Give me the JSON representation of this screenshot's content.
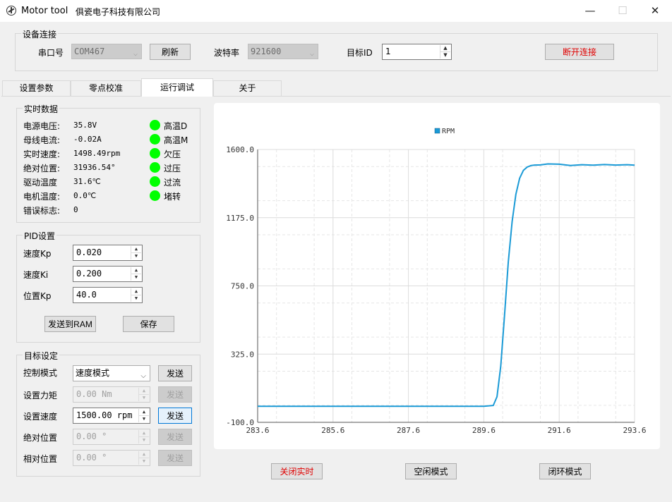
{
  "window": {
    "title": "Motor tool",
    "subtitle": "俱瓷电子科技有限公司",
    "minimize_glyph": "—",
    "maximize_glyph": "☐",
    "close_glyph": "✕"
  },
  "connection": {
    "group_title": "设备连接",
    "port_label": "串口号",
    "port_value": "COM467",
    "refresh_label": "刷新",
    "baud_label": "波特率",
    "baud_value": "921600",
    "target_id_label": "目标ID",
    "target_id_value": "1",
    "disconnect_label": "断开连接",
    "accent_color": "#e00000"
  },
  "tabs": [
    {
      "label": "设置参数"
    },
    {
      "label": "零点校准"
    },
    {
      "label": "运行调试",
      "active": true
    },
    {
      "label": "关于"
    }
  ],
  "realtime": {
    "group_title": "实时数据",
    "rows": [
      {
        "label": "电源电压:",
        "value": "35.8V"
      },
      {
        "label": "母线电流:",
        "value": "-0.02A"
      },
      {
        "label": "实时速度:",
        "value": "1498.49rpm"
      },
      {
        "label": "绝对位置:",
        "value": "31936.54°"
      },
      {
        "label": "驱动温度",
        "value": "31.6℃"
      },
      {
        "label": "电机温度:",
        "value": "0.0℃"
      },
      {
        "label": "错误标志:",
        "value": "0"
      }
    ],
    "indicators": [
      {
        "label": "高温D",
        "color": "#00ff00"
      },
      {
        "label": "高温M",
        "color": "#00ff00"
      },
      {
        "label": "欠压",
        "color": "#00ff00"
      },
      {
        "label": "过压",
        "color": "#00ff00"
      },
      {
        "label": "过流",
        "color": "#00ff00"
      },
      {
        "label": "堵转",
        "color": "#00ff00"
      }
    ]
  },
  "pid": {
    "group_title": "PID设置",
    "rows": [
      {
        "label": "速度Kp",
        "value": "0.020"
      },
      {
        "label": "速度Ki",
        "value": "0.200"
      },
      {
        "label": "位置Kp",
        "value": "40.0"
      }
    ],
    "send_ram_label": "发送到RAM",
    "save_label": "保存"
  },
  "target": {
    "group_title": "目标设定",
    "mode_label": "控制模式",
    "mode_value": "速度模式",
    "rows": [
      {
        "label": "设置力矩",
        "value": "0.00 Nm",
        "enabled": false
      },
      {
        "label": "设置速度",
        "value": "1500.00 rpm",
        "enabled": true
      },
      {
        "label": "绝对位置",
        "value": "0.00 °",
        "enabled": false
      },
      {
        "label": "相对位置",
        "value": "0.00 °",
        "enabled": false
      }
    ],
    "send_label": "发送"
  },
  "bottom_buttons": {
    "realtime_off": "关闭实时",
    "idle_mode": "空闲模式",
    "closed_loop": "闭环模式"
  },
  "chart_data": {
    "type": "line",
    "title": "",
    "xlabel": "",
    "ylabel": "",
    "legend_position": "top-center",
    "grid": true,
    "xlim": [
      283.6,
      293.6
    ],
    "ylim": [
      -100.0,
      1600.0
    ],
    "x_ticks": [
      "283.6",
      "285.6",
      "287.6",
      "289.6",
      "291.6",
      "293.6"
    ],
    "y_ticks": [
      "-100.0",
      "325.0",
      "750.0",
      "1175.0",
      "1600.0"
    ],
    "series": [
      {
        "name": "RPM",
        "color": "#1a9ad6",
        "x": [
          283.6,
          284.6,
          285.6,
          286.6,
          287.6,
          288.6,
          289.6,
          289.85,
          289.95,
          290.05,
          290.15,
          290.25,
          290.35,
          290.45,
          290.55,
          290.65,
          290.75,
          290.85,
          290.95,
          291.1,
          291.3,
          291.6,
          291.9,
          292.2,
          292.5,
          292.8,
          293.1,
          293.4,
          293.6
        ],
        "y": [
          0,
          0,
          0,
          0,
          0,
          0,
          0,
          5,
          60,
          250,
          570,
          900,
          1150,
          1320,
          1420,
          1470,
          1490,
          1500,
          1503,
          1504,
          1510,
          1508,
          1500,
          1505,
          1502,
          1506,
          1503,
          1505,
          1502
        ]
      }
    ]
  }
}
